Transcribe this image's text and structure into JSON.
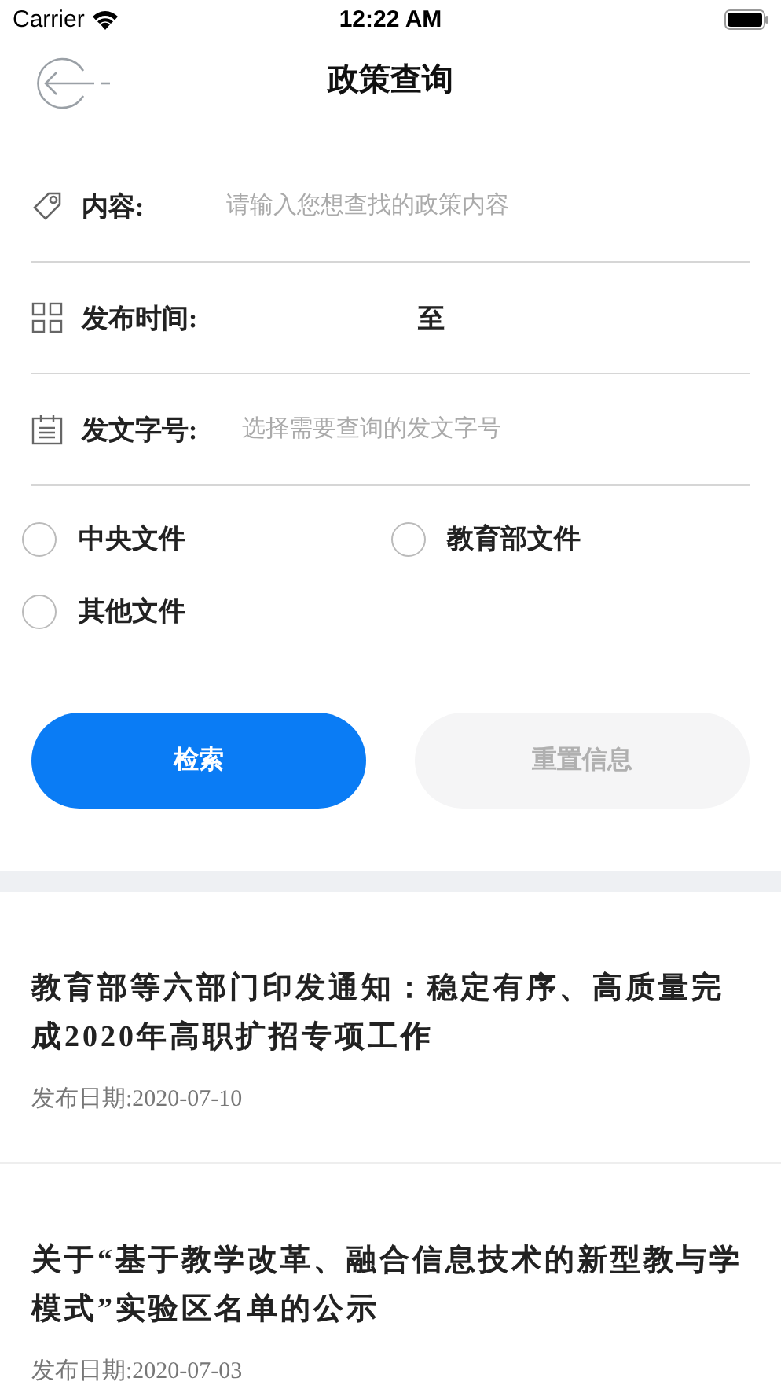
{
  "status_bar": {
    "carrier": "Carrier",
    "time": "12:22 AM"
  },
  "header": {
    "title": "政策查询"
  },
  "form": {
    "content": {
      "label": "内容:",
      "placeholder": "请输入您想查找的政策内容"
    },
    "date": {
      "label": "发布时间:",
      "separator": "至"
    },
    "doc_number": {
      "label": "发文字号:",
      "placeholder": "选择需要查询的发文字号"
    }
  },
  "categories": [
    {
      "label": "中央文件",
      "selected": false
    },
    {
      "label": "教育部文件",
      "selected": false
    },
    {
      "label": "其他文件",
      "selected": false
    }
  ],
  "buttons": {
    "search": "检索",
    "reset": "重置信息"
  },
  "articles": [
    {
      "title": "教育部等六部门印发通知：稳定有序、高质量完成2020年高职扩招专项工作",
      "date": "发布日期:2020-07-10"
    },
    {
      "title": "关于“基于教学改革、融合信息技术的新型教与学模式”实验区名单的公示",
      "date": "发布日期:2020-07-03"
    }
  ]
}
